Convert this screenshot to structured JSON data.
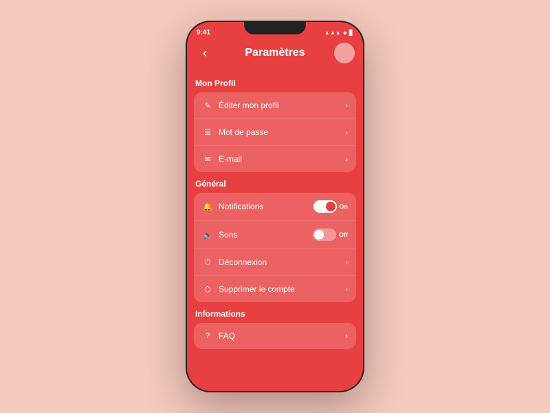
{
  "statusBar": {
    "time": "9:41",
    "signal": "▲▲▲",
    "wifi": "◈",
    "battery": "▊"
  },
  "header": {
    "backIcon": "‹",
    "title": "Paramètres"
  },
  "sections": [
    {
      "label": "Mon Profil",
      "items": [
        {
          "id": "edit-profile",
          "icon": "✎",
          "label": "Éditer mon profil",
          "type": "chevron"
        },
        {
          "id": "password",
          "icon": "☰",
          "label": "Mot de passe",
          "type": "chevron"
        },
        {
          "id": "email",
          "icon": "✉",
          "label": "E-mail",
          "type": "chevron"
        }
      ]
    },
    {
      "label": "Général",
      "items": [
        {
          "id": "notifications",
          "icon": "🔔",
          "label": "Notifications",
          "type": "toggle",
          "toggleState": "on",
          "toggleLabel": "On"
        },
        {
          "id": "sons",
          "icon": "🔈",
          "label": "Sons",
          "type": "toggle",
          "toggleState": "off",
          "toggleLabel": "Off"
        },
        {
          "id": "deconnexion",
          "icon": "⏻",
          "label": "Déconnexion",
          "type": "chevron"
        },
        {
          "id": "supprimer",
          "icon": "⬡",
          "label": "Supprimer le compte",
          "type": "chevron"
        }
      ]
    },
    {
      "label": "Informations",
      "items": [
        {
          "id": "faq",
          "icon": "?",
          "label": "FAQ",
          "type": "chevron"
        }
      ]
    }
  ],
  "chevron": "›"
}
